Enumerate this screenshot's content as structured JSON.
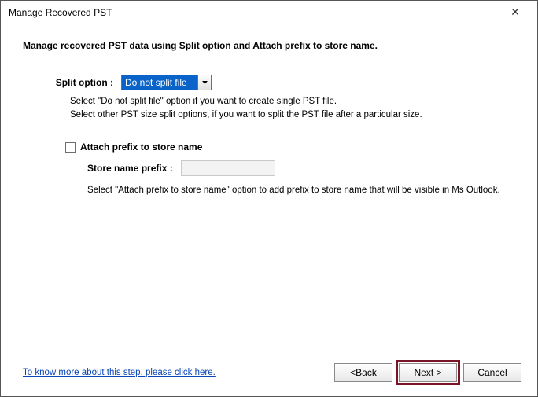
{
  "window": {
    "title": "Manage Recovered PST",
    "close_glyph": "✕"
  },
  "heading": "Manage recovered PST data using Split option and Attach prefix to store name.",
  "split": {
    "label": "Split option :",
    "selected": "Do not split file",
    "info1": "Select \"Do not split file\" option if you want to create single PST file.",
    "info2": "Select other PST size split options, if you want to split the PST file after a particular size."
  },
  "prefix": {
    "checkbox_label": "Attach prefix to store name",
    "input_label": "Store name prefix :",
    "input_value": "",
    "info": "Select \"Attach prefix to store name\" option to add prefix to store name that will be visible in Ms Outlook."
  },
  "footer": {
    "help_link": "To know more about this step, please click here.",
    "back_prefix": "< ",
    "back_uline": "B",
    "back_rest": "ack",
    "next_uline": "N",
    "next_rest": "ext >",
    "cancel": "Cancel"
  }
}
